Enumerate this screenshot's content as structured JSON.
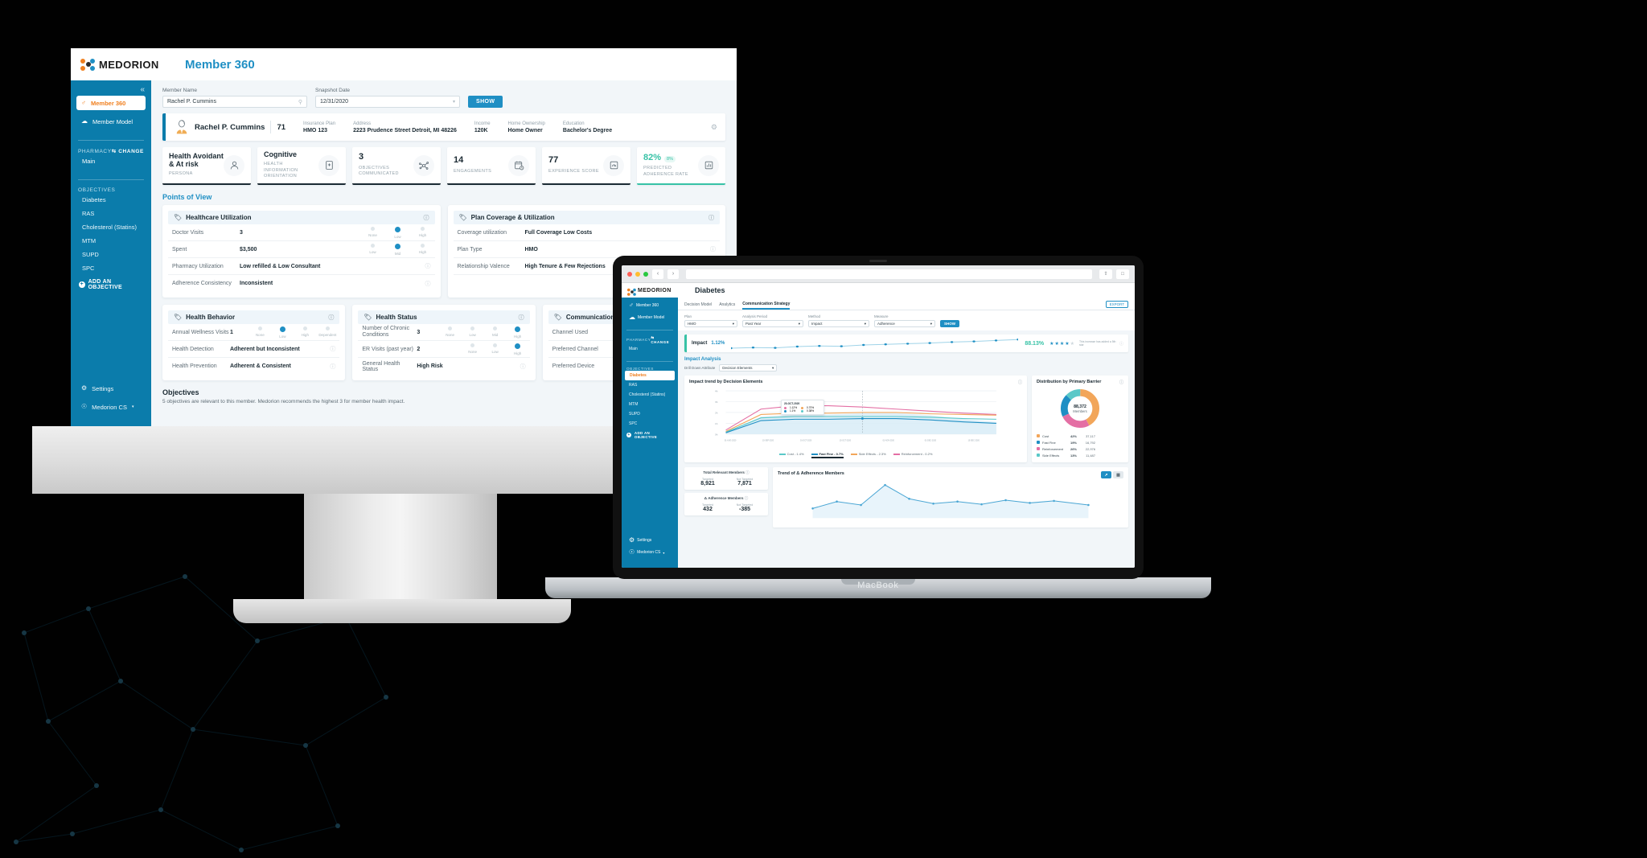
{
  "brand": {
    "name": "MEDORION",
    "accent": "#1f8fc4",
    "orange": "#f08020",
    "teal": "#37c2a6",
    "sidebar": "#0b7cab"
  },
  "device_labels": {
    "macbook": "MacBook"
  },
  "imac": {
    "app_title": "Member 360",
    "sidebar": {
      "collapse_icon": "chevrons-left-icon",
      "items": [
        {
          "label": "Member 360",
          "icon": "member-icon",
          "active": true
        },
        {
          "label": "Member Model",
          "icon": "model-icon",
          "active": false
        }
      ],
      "pharmacy_label": "PHARMACY",
      "change_label": "CHANGE",
      "pharmacy_value": "Main",
      "objectives_label": "OBJECTIVES",
      "objectives": [
        "Diabetes",
        "RAS",
        "Cholesterol (Statins)",
        "MTM",
        "SUPD",
        "SPC"
      ],
      "add_objective": "ADD AN OBJECTIVE",
      "bottom": [
        {
          "label": "Settings",
          "icon": "gear-icon"
        },
        {
          "label": "Medorion CS",
          "icon": "user-icon"
        }
      ]
    },
    "filters": {
      "member_name_label": "Member Name",
      "member_name_value": "Rachel P. Cummins",
      "member_name_placeholder": "Member Name",
      "snapshot_label": "Snapshot Date",
      "snapshot_value": "12/31/2020",
      "show_button": "SHOW"
    },
    "member": {
      "name": "Rachel P. Cummins",
      "age": "71",
      "fields": [
        {
          "key": "Insurance Plan",
          "value": "HMO 123"
        },
        {
          "key": "Address",
          "value": "2223 Prudence Street Detroit, MI 48226"
        },
        {
          "key": "Income",
          "value": "120K"
        },
        {
          "key": "Home Ownership",
          "value": "Home Owner"
        },
        {
          "key": "Education",
          "value": "Bachelor's Degree"
        }
      ]
    },
    "kpis": [
      {
        "value": "Health Avoidant\n& At risk",
        "caption": "PERSONA",
        "icon": "person-icon",
        "small": true
      },
      {
        "value": "Cognitive",
        "caption": "HEALTH INFORMATION\nORIENTATION",
        "icon": "book-plus-icon",
        "small": true
      },
      {
        "value": "3",
        "caption": "OBJECTIVES\nCOMMUNICATED",
        "icon": "network-icon",
        "small": false
      },
      {
        "value": "14",
        "caption": "ENGAGEMENTS",
        "icon": "calendar-clock-icon",
        "small": false
      },
      {
        "value": "77",
        "caption": "EXPERIENCE SCORE",
        "icon": "gauge-icon",
        "small": false
      },
      {
        "value": "82%",
        "badge": "8%",
        "caption": "PREDICTED\nADHERENCE RATE",
        "icon": "bar-chart-icon",
        "small": false,
        "accent": true
      }
    ],
    "points_of_view_title": "Points of View",
    "pov_cards": [
      {
        "title": "Healthcare Utilization",
        "rows": [
          {
            "key": "Doctor Visits",
            "value": "3",
            "scale": [
              "None",
              "Low",
              "High"
            ],
            "selected": 1
          },
          {
            "key": "Spent",
            "value": "$3,500",
            "scale": [
              "Low",
              "Mid",
              "High"
            ],
            "selected": 1
          },
          {
            "key": "Pharmacy Utilization",
            "value": "Low refilled & Low Consultant"
          },
          {
            "key": "Adherence Consistency",
            "value": "Inconsistent"
          }
        ]
      },
      {
        "title": "Plan Coverage & Utilization",
        "rows": [
          {
            "key": "Coverage utilization",
            "value": "Full Coverage Low Costs"
          },
          {
            "key": "Plan Type",
            "value": "HMO"
          },
          {
            "key": "Relationship Valence",
            "value": "High Tenure & Few Rejections"
          }
        ]
      }
    ],
    "pov_cards_row2": [
      {
        "title": "Health Behavior",
        "rows": [
          {
            "key": "Annual Wellness Visits",
            "value": "1",
            "scale": [
              "None",
              "Low",
              "High",
              "Dependent"
            ],
            "selected": 1
          },
          {
            "key": "Health Detection",
            "value": "Adherent but Inconsistent"
          },
          {
            "key": "Health Prevention",
            "value": "Adherent & Consistent"
          }
        ]
      },
      {
        "title": "Health Status",
        "rows": [
          {
            "key": "Number of Chronic Conditions",
            "value": "3",
            "scale": [
              "None",
              "Low",
              "Mid",
              "High"
            ],
            "selected": 3
          },
          {
            "key": "ER Visits (past year)",
            "value": "2",
            "scale": [
              "None",
              "Low",
              "High"
            ],
            "selected": 2
          },
          {
            "key": "General Health Status",
            "value": "High Risk"
          }
        ]
      },
      {
        "title": "Communication",
        "rows": [
          {
            "key": "Channel Used",
            "value": ""
          },
          {
            "key": "Preferred Channel",
            "value": ""
          },
          {
            "key": "Preferred Device",
            "value": ""
          }
        ]
      }
    ],
    "objectives_footer": {
      "title": "Objectives",
      "subtitle": "5 objectives are relevant to this member. Medorion recommends the highest 3 for member health impact."
    }
  },
  "macbook": {
    "browser": {
      "back_icon": "chevron-left-icon",
      "forward_icon": "chevron-right-icon",
      "share_icon": "share-icon",
      "tabs_icon": "tabs-icon",
      "url": ""
    },
    "app_title": "Diabetes",
    "tabs": [
      {
        "label": "Decision Model",
        "active": false
      },
      {
        "label": "Analytics",
        "active": false
      },
      {
        "label": "Communication Strategy",
        "active": true
      }
    ],
    "export_label": "EXPORT",
    "filters": [
      {
        "label": "Plan",
        "value": "HMO"
      },
      {
        "label": "Analysis Period",
        "value": "Past Year"
      },
      {
        "label": "Method",
        "value": "Impact"
      },
      {
        "label": "Measure",
        "value": "Adherence"
      }
    ],
    "show_button": "SHOW",
    "impact": {
      "label": "Impact",
      "value": "1.12%",
      "percent": "88.13%",
      "stars_filled": 4,
      "stars_total": 5,
      "note": "This increase has added a 5th star"
    },
    "analysis_title": "Impact Analysis",
    "drilldown": {
      "label": "Drill Down Attribute",
      "value": "Decision Elements"
    },
    "trend_card": {
      "title": "Impact trend by Decision Elements",
      "tooltip": {
        "date": "20-OCT-2020",
        "items": [
          {
            "label": "1.12%",
            "color": "#e46fa4"
          },
          {
            "label": "0.70%",
            "color": "#f2a65a"
          },
          {
            "label": "1.1%",
            "color": "#1f8fc4"
          },
          {
            "label": "0.38%",
            "color": "#5ac8c8"
          }
        ]
      },
      "legend": [
        {
          "label": "Cost - 1.4%",
          "color": "#5ac8c8",
          "active": false
        },
        {
          "label": "Fast Fine - 0.7%",
          "color": "#1b2a33",
          "active": true
        },
        {
          "label": "Side Effects - 2.3%",
          "color": "#f2a65a",
          "active": false
        },
        {
          "label": "Reinforcement - 0.2%",
          "color": "#e46fa4",
          "active": false
        }
      ],
      "y_ticks": [
        "4%",
        "3%",
        "2%",
        "1%",
        "0%"
      ],
      "x_ticks": [
        "01-AUG-2020",
        "15-SEP-2020",
        "01-OCT-2020",
        "15-OCT-2020",
        "01-NOV-2020",
        "01-DEC-2020",
        "15-DEC-2020"
      ]
    },
    "donut_card": {
      "title": "Distribution by Primary Barrier",
      "center_value": "88,372",
      "center_label": "Members",
      "legend": [
        {
          "label": "Cost",
          "pct": "42%",
          "count": "37,117",
          "color": "#f2a65a"
        },
        {
          "label": "Fast Fine",
          "pct": "19%",
          "count": "16,792",
          "color": "#1f8fc4"
        },
        {
          "label": "Reinforcement",
          "pct": "26%",
          "count": "22,976",
          "color": "#e46fa4"
        },
        {
          "label": "Side Effects",
          "pct": "13%",
          "count": "11,487",
          "color": "#5ac8c8"
        }
      ]
    },
    "mini_cards": [
      {
        "title": "Total Relevant Members",
        "cols": [
          {
            "k": "Targeted",
            "v": "8,921"
          },
          {
            "k": "Not Targeted",
            "v": "7,871"
          }
        ]
      },
      {
        "title": "Δ Adherence Members",
        "cols": [
          {
            "k": "Targeted",
            "v": "432"
          },
          {
            "k": "Not Targeted",
            "v": "-385"
          }
        ]
      }
    ],
    "adherence_card": {
      "title": "Trend of Δ Adherence Members",
      "view_line": "line-chart-icon",
      "view_table": "table-icon"
    },
    "sidebar": {
      "items": [
        {
          "label": "Member 360",
          "icon": "member-icon",
          "active": false
        },
        {
          "label": "Member Model",
          "icon": "model-icon",
          "active": false
        }
      ],
      "pharmacy_label": "PHARMACY",
      "change_label": "CHANGE",
      "pharmacy_value": "Main",
      "objectives_label": "OBJECTIVES",
      "objectives": [
        "Diabetes",
        "RAS",
        "Cholesterol (Statins)",
        "MTM",
        "SUPD",
        "SPC"
      ],
      "selected_objective": "Diabetes",
      "add_objective": "ADD AN OBJECTIVE",
      "bottom": [
        {
          "label": "Settings",
          "icon": "gear-icon"
        },
        {
          "label": "Medorion CS",
          "icon": "user-icon"
        }
      ]
    }
  },
  "chart_data": [
    {
      "type": "line",
      "title": "Impact trend by Decision Elements",
      "xlabel": "",
      "ylabel": "",
      "ylim": [
        0,
        4
      ],
      "y_ticks": [
        0,
        1,
        2,
        3,
        4
      ],
      "x": [
        "01-AUG-2020",
        "15-SEP-2020",
        "01-OCT-2020",
        "15-OCT-2020",
        "01-NOV-2020",
        "01-DEC-2020",
        "15-DEC-2020"
      ],
      "series": [
        {
          "name": "Reinforcement",
          "color": "#e46fa4",
          "values": [
            0.4,
            2.3,
            2.6,
            2.6,
            2.5,
            2.3,
            2.0,
            1.9
          ]
        },
        {
          "name": "Side Effects",
          "color": "#f2a65a",
          "values": [
            0.3,
            1.6,
            1.7,
            1.7,
            1.8,
            1.8,
            1.7,
            1.6
          ]
        },
        {
          "name": "Cost",
          "color": "#5ac8c8",
          "values": [
            0.2,
            1.1,
            1.2,
            1.2,
            1.2,
            1.2,
            1.1,
            1.0
          ]
        },
        {
          "name": "Fast Fine",
          "color": "#1f8fc4",
          "values": [
            0.1,
            0.8,
            0.9,
            0.9,
            1.0,
            1.0,
            0.9,
            0.7
          ]
        }
      ],
      "legend_position": "bottom",
      "grid": true
    },
    {
      "type": "pie",
      "title": "Distribution by Primary Barrier",
      "labels": [
        "Cost",
        "Reinforcement",
        "Fast Fine",
        "Side Effects"
      ],
      "values": [
        42,
        26,
        19,
        13
      ],
      "counts": [
        37117,
        22976,
        16792,
        11487
      ],
      "colors": [
        "#f2a65a",
        "#e46fa4",
        "#1f8fc4",
        "#5ac8c8"
      ],
      "center_value": "88,372",
      "center_label": "Members"
    },
    {
      "type": "area",
      "title": "Trend of Δ Adherence Members",
      "x": [
        1,
        2,
        3,
        4,
        5,
        6,
        7,
        8,
        9,
        10,
        11,
        12
      ],
      "values": [
        30,
        42,
        36,
        95,
        52,
        40,
        44,
        38,
        46,
        40,
        44,
        36
      ],
      "color": "#1f8fc4",
      "grid": false
    },
    {
      "type": "line",
      "title": "Impact sparkline",
      "x": [
        1,
        2,
        3,
        4,
        5,
        6,
        7,
        8,
        9,
        10,
        11,
        12,
        13,
        14
      ],
      "values": [
        20,
        24,
        22,
        30,
        34,
        32,
        40,
        44,
        48,
        52,
        58,
        62,
        68,
        74
      ],
      "color": "#1f8fc4",
      "grid": false
    }
  ]
}
